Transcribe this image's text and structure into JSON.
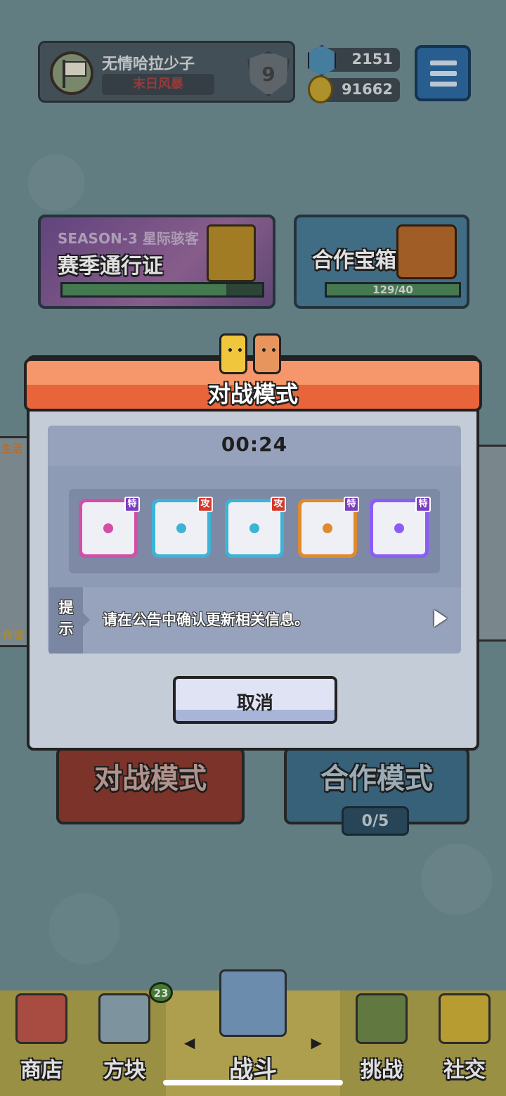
{
  "profile": {
    "name": "无情哈拉少子",
    "clan": "末日风暴",
    "rank": "9"
  },
  "currencies": [
    {
      "icon": "gem-icon",
      "value": "2151"
    },
    {
      "icon": "coin-icon",
      "value": "91662"
    }
  ],
  "season_pass": {
    "subtitle": "SEASON-3 星际骇客",
    "title": "赛季通行证",
    "progress": 0.82
  },
  "coop_chest": {
    "title": "合作宝箱",
    "progress_text": "129/40",
    "progress": 1.0
  },
  "side": {
    "left_top": "生活",
    "left_bottom": "传说"
  },
  "modes": {
    "battle": "对战模式",
    "coop": "合作模式",
    "coop_count": "0/5"
  },
  "modal": {
    "title": "对战模式",
    "timer": "00:24",
    "deck": [
      {
        "tag": "特",
        "color": "#d14fa6",
        "tag_color": "#7b3fbf"
      },
      {
        "tag": "攻",
        "color": "#3db3d6",
        "tag_color": "#d63a2e"
      },
      {
        "tag": "攻",
        "color": "#3db3d6",
        "tag_color": "#d63a2e"
      },
      {
        "tag": "特",
        "color": "#e08a2e",
        "tag_color": "#7b3fbf"
      },
      {
        "tag": "特",
        "color": "#8b5cf6",
        "tag_color": "#7b3fbf"
      }
    ],
    "hint_label_1": "提",
    "hint_label_2": "示",
    "hint_text": "请在公告中确认更新相关信息。",
    "cancel": "取消"
  },
  "nav": {
    "shop": "商店",
    "dice": "方块",
    "dice_badge": "23",
    "battle": "战斗",
    "challenge": "挑战",
    "social": "社交"
  }
}
